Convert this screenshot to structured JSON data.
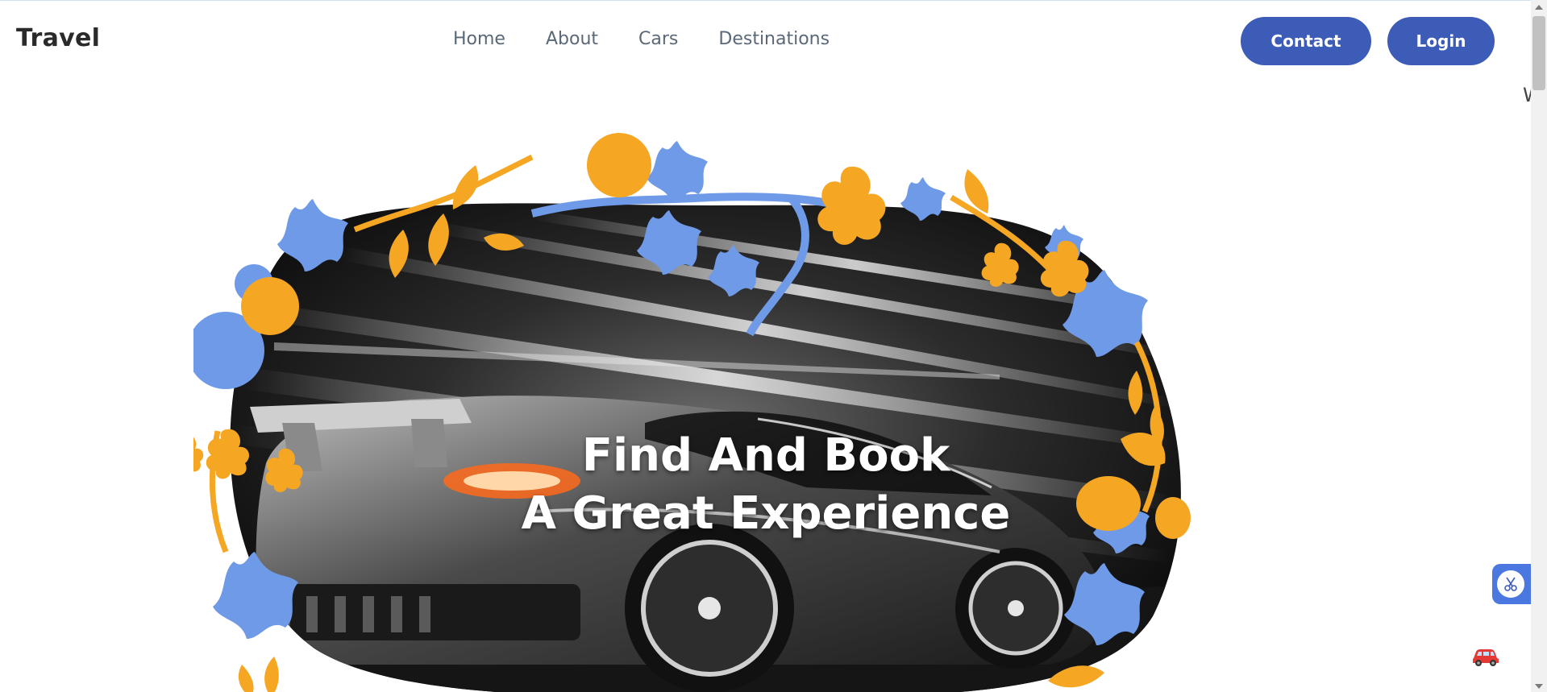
{
  "header": {
    "logo": "Travel",
    "nav": [
      {
        "label": "Home"
      },
      {
        "label": "About"
      },
      {
        "label": "Cars"
      },
      {
        "label": "Destinations"
      }
    ],
    "contact_label": "Contact",
    "login_label": "Login"
  },
  "edge_text": "W",
  "hero": {
    "title_line1": "Find And Book",
    "title_line2": "A Great Experience",
    "image_icon": "sports-car-with-flower-frame-image"
  },
  "widgets": {
    "side_tab_icon": "scissors-icon",
    "floating_icon": "red-car-icon"
  },
  "colors": {
    "accent": "#3d5cb8",
    "flower_blue": "#6f9ae8",
    "flower_orange": "#f5a623"
  }
}
